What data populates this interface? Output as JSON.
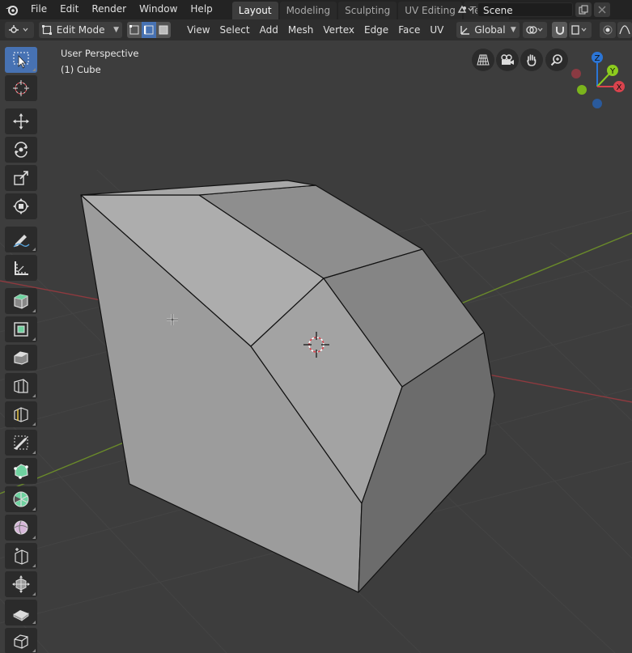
{
  "menubar": {
    "items": [
      "File",
      "Edit",
      "Render",
      "Window",
      "Help"
    ],
    "workspaces": [
      {
        "label": "Layout",
        "active": true
      },
      {
        "label": "Modeling",
        "active": false
      },
      {
        "label": "Sculpting",
        "active": false
      },
      {
        "label": "UV Editing",
        "active": false
      },
      {
        "label": "Texturi",
        "active": false
      }
    ],
    "scene_name": "Scene"
  },
  "header": {
    "mode": "Edit Mode",
    "menus": [
      "View",
      "Select",
      "Add",
      "Mesh",
      "Vertex",
      "Edge",
      "Face",
      "UV"
    ],
    "transform_orientation": "Global"
  },
  "viewport": {
    "view_name": "User Perspective",
    "object_info": "(1) Cube",
    "gizmo_axes": [
      "Z",
      "Y",
      "X"
    ],
    "colors": {
      "x_axis": "#d9434d",
      "y_axis": "#8ccc1e",
      "z_axis": "#2b75d6",
      "select_active": "#4772b3",
      "background": "#3d3d3d"
    }
  },
  "toolbar": {
    "tools": [
      "select-box",
      "cursor",
      "move",
      "rotate",
      "scale",
      "transform",
      "annotate",
      "measure",
      "add-cube",
      "extrude-region",
      "inset-faces",
      "bevel",
      "loop-cut",
      "knife",
      "poly-build",
      "spin",
      "smooth",
      "edge-slide",
      "shrink-fatten",
      "shear",
      "rip-region"
    ]
  }
}
